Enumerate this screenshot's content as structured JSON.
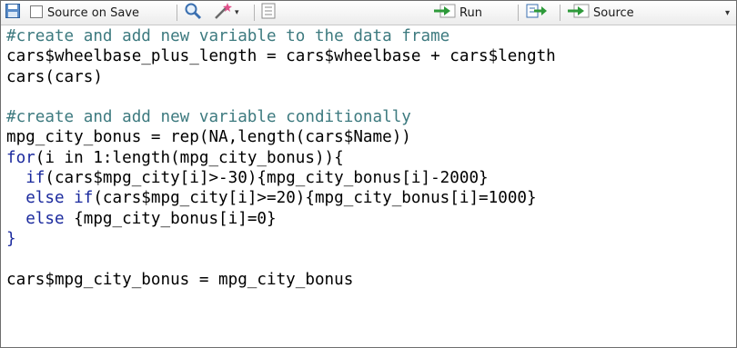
{
  "toolbar": {
    "source_on_save_label": "Source on Save",
    "run_label": "Run",
    "source_label": "Source",
    "icons": [
      "save-icon",
      "checkbox-icon",
      "search-icon",
      "magic-wand-icon",
      "compile-report-icon",
      "run-arrow-icon",
      "rerun-icon",
      "source-arrow-icon",
      "chevron-down-icon"
    ]
  },
  "editor": {
    "lines": [
      {
        "comment": "#create and add new variable to the data frame"
      },
      {
        "code": "cars$wheelbase_plus_length = cars$wheelbase + cars$length"
      },
      {
        "code": "cars(cars)"
      },
      {
        "code": ""
      },
      {
        "comment": "#create and add new variable conditionally"
      },
      {
        "code": "mpg_city_bonus = rep(NA,length(cars$Name))"
      },
      {
        "kw": "for",
        "rest": "(i in 1:length(mpg_city_bonus)){"
      },
      {
        "indent": "  ",
        "kw": "if",
        "rest": "(cars$mpg_city[i]>-30){mpg_city_bonus[i]-2000}"
      },
      {
        "indent": "  ",
        "kw": "else if",
        "rest": "(cars$mpg_city[i]>=20){mpg_city_bonus[i]=1000}"
      },
      {
        "indent": "  ",
        "kw": "else",
        "rest": " {mpg_city_bonus[i]=0}"
      },
      {
        "kw": "}"
      },
      {
        "code": ""
      },
      {
        "code": "cars$mpg_city_bonus = mpg_city_bonus"
      }
    ]
  },
  "colors": {
    "comment": "#3d7a7f",
    "keyword": "#1b2a9e",
    "text": "#000000",
    "run_arrow": "#2e9a3a"
  }
}
